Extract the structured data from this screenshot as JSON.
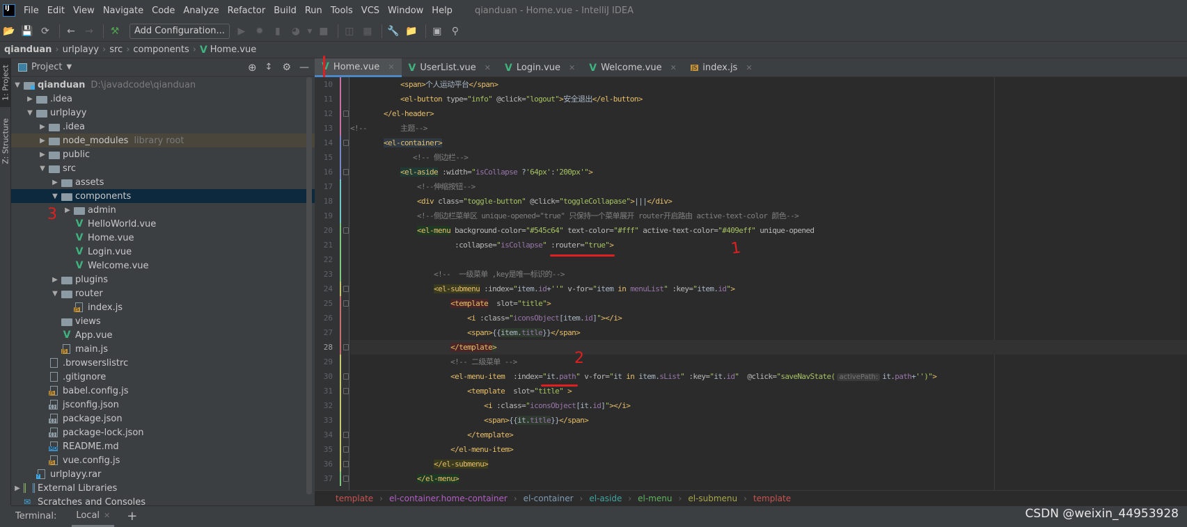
{
  "window": {
    "title": "qianduan - Home.vue - IntelliJ IDEA",
    "logo": "IJ"
  },
  "menu": [
    "File",
    "Edit",
    "View",
    "Navigate",
    "Code",
    "Analyze",
    "Refactor",
    "Build",
    "Run",
    "Tools",
    "VCS",
    "Window",
    "Help"
  ],
  "toolbar": {
    "add_configuration": "Add Configuration...",
    "icons_left": [
      "open-folder-icon",
      "save-icon",
      "sync-icon",
      "back-icon",
      "forward-icon",
      "build-hammer-icon"
    ],
    "icons_right": [
      "run-icon",
      "debug-icon",
      "coverage-icon",
      "profile-icon",
      "dropdown-icon",
      "stop-icon",
      "attach-icon",
      "deploy-icon",
      "settings-wrench-icon",
      "project-structure-icon",
      "terminal-frame-icon",
      "search-icon"
    ]
  },
  "breadcrumb": [
    "qianduan",
    "urlplayy",
    "src",
    "components",
    "Home.vue"
  ],
  "side_tabs": {
    "project": "1: Project",
    "structure": "Z: Structure"
  },
  "project_panel": {
    "title": "Project"
  },
  "tree": [
    {
      "level": 0,
      "arrow": "down",
      "icon": "module",
      "label": "qianduan",
      "extra": "D:\\javadcode\\qianduan",
      "bold": true
    },
    {
      "level": 1,
      "arrow": "right",
      "icon": "folder",
      "label": ".idea"
    },
    {
      "level": 1,
      "arrow": "down",
      "icon": "folder",
      "label": "urlplayy"
    },
    {
      "level": 2,
      "arrow": "right",
      "icon": "folder",
      "label": ".idea"
    },
    {
      "level": 2,
      "arrow": "right",
      "icon": "folder",
      "label": "node_modules",
      "extra": "library root",
      "lib": true
    },
    {
      "level": 2,
      "arrow": "right",
      "icon": "folder",
      "label": "public"
    },
    {
      "level": 2,
      "arrow": "down",
      "icon": "folder",
      "label": "src"
    },
    {
      "level": 3,
      "arrow": "right",
      "icon": "folder",
      "label": "assets"
    },
    {
      "level": 3,
      "arrow": "down",
      "icon": "folder",
      "label": "components",
      "selected": true
    },
    {
      "level": 4,
      "arrow": "right",
      "icon": "folder",
      "label": "admin"
    },
    {
      "level": 4,
      "arrow": "",
      "icon": "vue",
      "label": "HelloWorld.vue"
    },
    {
      "level": 4,
      "arrow": "",
      "icon": "vue",
      "label": "Home.vue"
    },
    {
      "level": 4,
      "arrow": "",
      "icon": "vue",
      "label": "Login.vue"
    },
    {
      "level": 4,
      "arrow": "",
      "icon": "vue",
      "label": "Welcome.vue"
    },
    {
      "level": 3,
      "arrow": "right",
      "icon": "folder",
      "label": "plugins"
    },
    {
      "level": 3,
      "arrow": "down",
      "icon": "folder",
      "label": "router"
    },
    {
      "level": 4,
      "arrow": "",
      "icon": "js",
      "label": "index.js"
    },
    {
      "level": 3,
      "arrow": "",
      "icon": "folder",
      "label": "views"
    },
    {
      "level": 3,
      "arrow": "",
      "icon": "vue",
      "label": "App.vue"
    },
    {
      "level": 3,
      "arrow": "",
      "icon": "js",
      "label": "main.js"
    },
    {
      "level": 2,
      "arrow": "",
      "icon": "file",
      "label": ".browserslistrc"
    },
    {
      "level": 2,
      "arrow": "",
      "icon": "file",
      "label": ".gitignore"
    },
    {
      "level": 2,
      "arrow": "",
      "icon": "js",
      "label": "babel.config.js"
    },
    {
      "level": 2,
      "arrow": "",
      "icon": "json",
      "label": "jsconfig.json"
    },
    {
      "level": 2,
      "arrow": "",
      "icon": "json",
      "label": "package.json"
    },
    {
      "level": 2,
      "arrow": "",
      "icon": "json",
      "label": "package-lock.json"
    },
    {
      "level": 2,
      "arrow": "",
      "icon": "md",
      "label": "README.md"
    },
    {
      "level": 2,
      "arrow": "",
      "icon": "js",
      "label": "vue.config.js"
    },
    {
      "level": 1,
      "arrow": "",
      "icon": "rar",
      "label": "urlplayy.rar"
    },
    {
      "level": 0,
      "arrow": "right",
      "icon": "library",
      "label": "External Libraries"
    },
    {
      "level": 0,
      "arrow": "",
      "icon": "scratch",
      "label": "Scratches and Consoles"
    }
  ],
  "tabs": [
    {
      "label": "Home.vue",
      "icon": "vue",
      "active": true
    },
    {
      "label": "UserList.vue",
      "icon": "vue"
    },
    {
      "label": "Login.vue",
      "icon": "vue"
    },
    {
      "label": "Welcome.vue",
      "icon": "vue"
    },
    {
      "label": "index.js",
      "icon": "js"
    }
  ],
  "current_line": 28,
  "code": [
    {
      "n": 10,
      "tokens": [
        [
          "d",
          "            "
        ],
        [
          "t",
          "<span>"
        ],
        [
          "d",
          "个人运动平台"
        ],
        [
          "t",
          "</span>"
        ]
      ]
    },
    {
      "n": 11,
      "tokens": [
        [
          "d",
          "            "
        ],
        [
          "t",
          "<el-button "
        ],
        [
          "a",
          "type="
        ],
        [
          "s",
          "\"info\" "
        ],
        [
          "a",
          "@click="
        ],
        [
          "s",
          "\"logout\""
        ],
        [
          "t",
          ">"
        ],
        [
          "d",
          "安全退出"
        ],
        [
          "t",
          "</el-button>"
        ]
      ]
    },
    {
      "n": 12,
      "tokens": [
        [
          "d",
          "        "
        ],
        [
          "t",
          "</el-header>"
        ]
      ]
    },
    {
      "n": 13,
      "tokens": [
        [
          "c",
          "<!--        主题-->"
        ]
      ]
    },
    {
      "n": 14,
      "tokens": [
        [
          "d",
          "        "
        ],
        [
          "t hc",
          "<el-container>"
        ]
      ]
    },
    {
      "n": 15,
      "tokens": [
        [
          "d",
          "               "
        ],
        [
          "c",
          "<!-- 侧边栏-->"
        ]
      ]
    },
    {
      "n": 16,
      "tokens": [
        [
          "d",
          "            "
        ],
        [
          "t ha",
          "<el-aside"
        ],
        [
          "a",
          " :width="
        ],
        [
          "s",
          "\""
        ],
        [
          "p",
          "isCollapse "
        ],
        [
          "d",
          "?"
        ],
        [
          "s",
          "'64px'"
        ],
        [
          "d",
          ":"
        ],
        [
          "s",
          "'200px'\""
        ],
        [
          "t",
          ">"
        ]
      ]
    },
    {
      "n": 17,
      "tokens": [
        [
          "d",
          "                "
        ],
        [
          "c",
          "<!--伸缩按钮-->"
        ]
      ]
    },
    {
      "n": 18,
      "tokens": [
        [
          "d",
          "                "
        ],
        [
          "t",
          "<div "
        ],
        [
          "a",
          "class="
        ],
        [
          "s",
          "\"toggle-button\" "
        ],
        [
          "a",
          "@click="
        ],
        [
          "s",
          "\"toggleCollapase\""
        ],
        [
          "t",
          ">"
        ],
        [
          "d",
          "|||"
        ],
        [
          "t",
          "</div>"
        ]
      ]
    },
    {
      "n": 19,
      "tokens": [
        [
          "d",
          "                "
        ],
        [
          "c",
          "<!--侧边栏菜单区 unique-opened=\"true\" 只保持一个菜单展开 router开启路由 active-text-color 颜色-->"
        ]
      ]
    },
    {
      "n": 20,
      "tokens": [
        [
          "d",
          "                "
        ],
        [
          "t hm",
          "<el-menu"
        ],
        [
          "a",
          " background-color="
        ],
        [
          "s",
          "\"#545c64\" "
        ],
        [
          "a",
          "text-color="
        ],
        [
          "s",
          "\"#fff\" "
        ],
        [
          "a",
          "active-text-color="
        ],
        [
          "s",
          "\"#409eff\" "
        ],
        [
          "a",
          "unique-opened"
        ]
      ]
    },
    {
      "n": 21,
      "tokens": [
        [
          "d",
          "                         "
        ],
        [
          "a",
          ":collapse="
        ],
        [
          "s",
          "\""
        ],
        [
          "p",
          "isCollapse"
        ],
        [
          "s",
          "\" "
        ],
        [
          "a",
          ":router="
        ],
        [
          "s",
          "\"true\""
        ],
        [
          "t",
          ">"
        ]
      ]
    },
    {
      "n": 22,
      "tokens": []
    },
    {
      "n": 23,
      "tokens": [
        [
          "d",
          "                    "
        ],
        [
          "c",
          "<!--  一级菜单 ,key是唯一标识的-->"
        ]
      ]
    },
    {
      "n": 24,
      "tokens": [
        [
          "d",
          "                    "
        ],
        [
          "t hs",
          "<el-submenu"
        ],
        [
          "a",
          " :index="
        ],
        [
          "s",
          "\""
        ],
        [
          "d",
          "item."
        ],
        [
          "p",
          "id"
        ],
        [
          "d",
          "+"
        ],
        [
          "s",
          "''\" "
        ],
        [
          "a",
          "v-for="
        ],
        [
          "s",
          "\""
        ],
        [
          "d",
          "item "
        ],
        [
          "t",
          "in "
        ],
        [
          "p",
          "menuList"
        ],
        [
          "s",
          "\" "
        ],
        [
          "a",
          ":key="
        ],
        [
          "s",
          "\""
        ],
        [
          "d",
          "item."
        ],
        [
          "p",
          "id"
        ],
        [
          "s",
          "\""
        ],
        [
          "t",
          ">"
        ]
      ]
    },
    {
      "n": 25,
      "tokens": [
        [
          "d",
          "                        "
        ],
        [
          "t ht",
          "<template"
        ],
        [
          "a",
          "  slot="
        ],
        [
          "s",
          "\"title\""
        ],
        [
          "t",
          ">"
        ]
      ]
    },
    {
      "n": 26,
      "tokens": [
        [
          "d",
          "                            "
        ],
        [
          "t",
          "<i "
        ],
        [
          "a",
          ":class="
        ],
        [
          "s",
          "\""
        ],
        [
          "p",
          "iconsObject"
        ],
        [
          "d",
          "[item."
        ],
        [
          "p",
          "id"
        ],
        [
          "d",
          "]"
        ],
        [
          "s",
          "\""
        ],
        [
          "t",
          "></i>"
        ]
      ]
    },
    {
      "n": 27,
      "tokens": [
        [
          "d",
          "                            "
        ],
        [
          "t",
          "<span>"
        ],
        [
          "d",
          "{{"
        ],
        [
          "d hv",
          "item."
        ],
        [
          "p hv",
          "title"
        ],
        [
          "d",
          "}}"
        ],
        [
          "t",
          "</span>"
        ]
      ]
    },
    {
      "n": 28,
      "tokens": [
        [
          "d",
          "                        "
        ],
        [
          "t ht",
          "</template"
        ],
        [
          "t hv",
          ">"
        ]
      ]
    },
    {
      "n": 29,
      "tokens": [
        [
          "d",
          "                        "
        ],
        [
          "c",
          "<!-- 二级菜单 -->"
        ]
      ]
    },
    {
      "n": 30,
      "tokens": [
        [
          "d",
          "                        "
        ],
        [
          "t",
          "<el-menu-item  "
        ],
        [
          "a",
          ":index="
        ],
        [
          "s",
          "\""
        ],
        [
          "d",
          "it."
        ],
        [
          "p",
          "path"
        ],
        [
          "s",
          "\" "
        ],
        [
          "a",
          "v-for="
        ],
        [
          "s",
          "\""
        ],
        [
          "d",
          "it "
        ],
        [
          "t",
          "in "
        ],
        [
          "d",
          "item."
        ],
        [
          "p",
          "sList"
        ],
        [
          "s",
          "\" "
        ],
        [
          "a",
          ":key="
        ],
        [
          "s",
          "\""
        ],
        [
          "d",
          "it."
        ],
        [
          "p",
          "id"
        ],
        [
          "s",
          "\"  "
        ],
        [
          "a",
          "@click="
        ],
        [
          "s",
          "\"saveNavState("
        ],
        [
          "hint",
          "activePath:"
        ],
        [
          "d",
          "it."
        ],
        [
          "p",
          "path"
        ],
        [
          "d",
          "+"
        ],
        [
          "s",
          "'')\""
        ],
        [
          "t",
          ">"
        ]
      ]
    },
    {
      "n": 31,
      "tokens": [
        [
          "d",
          "                            "
        ],
        [
          "t",
          "<template  "
        ],
        [
          "a",
          "slot="
        ],
        [
          "s",
          "\"title\" "
        ],
        [
          "t",
          ">"
        ]
      ]
    },
    {
      "n": 32,
      "tokens": [
        [
          "d",
          "                                "
        ],
        [
          "t",
          "<i "
        ],
        [
          "a",
          ":class="
        ],
        [
          "s",
          "\""
        ],
        [
          "p",
          "iconsObject"
        ],
        [
          "d",
          "[it."
        ],
        [
          "p",
          "id"
        ],
        [
          "d",
          "]"
        ],
        [
          "s",
          "\""
        ],
        [
          "t",
          "></i>"
        ]
      ]
    },
    {
      "n": 33,
      "tokens": [
        [
          "d",
          "                                "
        ],
        [
          "t",
          "<span>"
        ],
        [
          "d",
          "{{"
        ],
        [
          "d hv",
          "it."
        ],
        [
          "p hv",
          "title"
        ],
        [
          "d",
          "}}"
        ],
        [
          "t",
          "</span>"
        ]
      ]
    },
    {
      "n": 34,
      "tokens": [
        [
          "d",
          "                            "
        ],
        [
          "t",
          "</template>"
        ]
      ]
    },
    {
      "n": 35,
      "tokens": [
        [
          "d",
          "                        "
        ],
        [
          "t",
          "</el-menu-item>"
        ]
      ]
    },
    {
      "n": 36,
      "tokens": [
        [
          "d",
          "                    "
        ],
        [
          "t hs",
          "</el-submenu>"
        ]
      ]
    },
    {
      "n": 37,
      "tokens": [
        [
          "d",
          "                "
        ],
        [
          "t hm",
          "</el-menu>"
        ]
      ]
    }
  ],
  "code_breadcrumb": [
    {
      "label": "template",
      "color": "#c75450"
    },
    {
      "label": "el-container.home-container",
      "color": "#b05fc4"
    },
    {
      "label": "el-container",
      "color": "#7f9bb3"
    },
    {
      "label": "el-aside",
      "color": "#3fa5a0"
    },
    {
      "label": "el-menu",
      "color": "#5fb35f"
    },
    {
      "label": "el-submenu",
      "color": "#a8a84a"
    },
    {
      "label": "template",
      "color": "#c75450"
    }
  ],
  "terminal": {
    "label": "Terminal:",
    "tab": "Local",
    "add": "+"
  },
  "watermark": "CSDN @weixin_44953928",
  "annotations": [
    "1",
    "2",
    "3"
  ],
  "colors": {
    "editor_bg": "#2b2b2b",
    "panel_bg": "#3c3f41",
    "selection": "#0d293e",
    "tag": "#e8bf6a",
    "string": "#a5c261",
    "comment": "#808080",
    "annotation": "#e02020"
  }
}
